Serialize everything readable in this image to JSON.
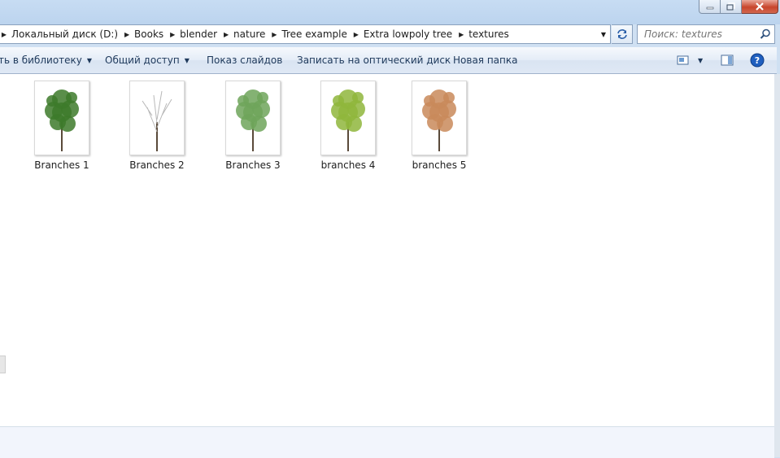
{
  "breadcrumb": {
    "items": [
      "Локальный диск (D:)",
      "Books",
      "blender",
      "nature",
      "Tree example",
      "Extra lowpoly tree",
      "textures"
    ]
  },
  "search": {
    "placeholder": "Поиск: textures"
  },
  "toolbar": {
    "library_label": "ть в библиотеку",
    "share_label": "Общий доступ",
    "slideshow_label": "Показ слайдов",
    "burn_label": "Записать на оптический диск",
    "new_folder_label": "Новая папка"
  },
  "files": [
    {
      "name": "Branches 1",
      "icon": "tree-thumbnail-icon",
      "color": "#3d7a2a"
    },
    {
      "name": "Branches 2",
      "icon": "bare-tree-thumbnail-icon",
      "color": "#b8b8b8"
    },
    {
      "name": "Branches 3",
      "icon": "tree-thumbnail-icon",
      "color": "#6ea45a"
    },
    {
      "name": "branches 4",
      "icon": "tree-thumbnail-icon",
      "color": "#8fb63c"
    },
    {
      "name": "branches 5",
      "icon": "autumn-tree-thumbnail-icon",
      "color": "#c98a5a"
    }
  ],
  "colors": {
    "window_frame": "#cfe0f2",
    "toolbar_text": "#1e395b",
    "close_button": "#c8452c",
    "help_icon": "#1f5fbf"
  }
}
